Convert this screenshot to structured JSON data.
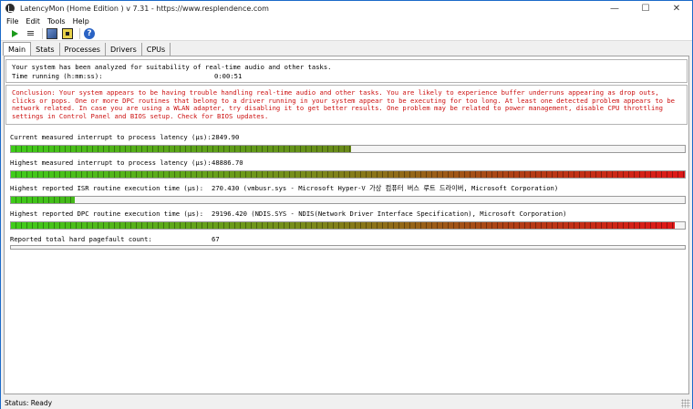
{
  "window": {
    "title": "LatencyMon  (Home Edition )  v 7.31 - https://www.resplendence.com",
    "controls": {
      "minimize": "—",
      "maximize": "☐",
      "close": "✕"
    }
  },
  "menu": [
    "File",
    "Edit",
    "Tools",
    "Help"
  ],
  "toolbar": [
    {
      "name": "start-monitor-button",
      "icon": "play-icon"
    },
    {
      "name": "stop-monitor-button",
      "icon": "stop-icon"
    },
    {
      "name": "cpu-info-button",
      "icon": "cpu-icon"
    },
    {
      "name": "driver-info-button",
      "icon": "chip-icon"
    },
    {
      "name": "help-button",
      "icon": "help-icon"
    }
  ],
  "tabs": [
    {
      "label": "Main",
      "active": true
    },
    {
      "label": "Stats",
      "active": false
    },
    {
      "label": "Processes",
      "active": false
    },
    {
      "label": "Drivers",
      "active": false
    },
    {
      "label": "CPUs",
      "active": false
    }
  ],
  "summary": {
    "line1": "Your system has been analyzed for suitability of real-time audio and other tasks.",
    "time_label": "Time running (h:mm:ss):",
    "time_value": "0:00:51"
  },
  "conclusion": "Conclusion: Your system appears to be having trouble handling real-time audio and other tasks. You are likely to experience buffer underruns appearing as drop outs, clicks or pops. One or more DPC routines that belong to a driver running in your system appear to be executing for too long. At least one detected problem appears to be network related. In case you are using a WLAN adapter, try disabling it to get better results. One problem may be related to power management, disable CPU throttling settings in Control Panel and BIOS setup. Check for BIOS updates.",
  "metrics": [
    {
      "label": "Current measured interrupt to process latency (µs):",
      "value": "2849.90",
      "fill": 0.505,
      "gradient": "linear-gradient(90deg, #3fcc1a 0%, #5aa81a 45%, #6a8a1a 100%)"
    },
    {
      "label": "Highest measured interrupt to process latency (µs):",
      "value": "48886.70",
      "fill": 1.0,
      "gradient": "linear-gradient(90deg, #3fcc1a 0%, #7a8a1a 45%, #b04016 75%, #e01818 100%)"
    },
    {
      "label": "Highest reported ISR routine execution time (µs):",
      "value": "270.430  (vmbusr.sys - Microsoft Hyper-V 가상 컴퓨터 버스 루트 드라이버, Microsoft Corporation)",
      "fill": 0.095,
      "gradient": "linear-gradient(90deg, #3fcc1a 0%, #45b81a 100%)"
    },
    {
      "label": "Highest reported DPC routine execution time (µs):",
      "value": "29196.420  (NDIS.SYS - NDIS(Network Driver Interface Specification), Microsoft Corporation)",
      "fill": 0.985,
      "gradient": "linear-gradient(90deg, #3fcc1a 0%, #7a8a1a 45%, #b04016 75%, #e01818 100%)"
    },
    {
      "label": "Reported total hard pagefault count:",
      "value": "67",
      "fill": 0.0,
      "gradient": "none"
    }
  ],
  "status": "Status: Ready"
}
